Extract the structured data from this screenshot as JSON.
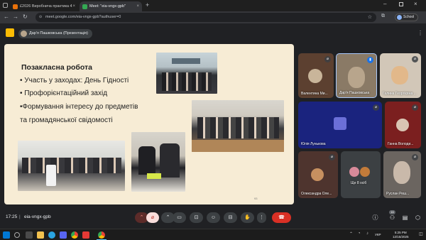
{
  "browser": {
    "tabs": [
      {
        "label": "£2026 Виробнича практикa 4",
        "active": false,
        "color": "#e8710a"
      },
      {
        "label": "Meet: \"eia-vngx-gpb\"",
        "active": true,
        "color": "#34a853"
      }
    ],
    "new_tab": "+",
    "url": "meet.google.com/eia-vngx-gpb?authuser=0",
    "profile": "School"
  },
  "meet": {
    "presenter_label": "Дар'я Пашковська (Презентація)"
  },
  "slide": {
    "title": "Позакласна робота",
    "bullets": [
      "• Участь у заходах: День Гідності",
      "• Профорієнтаційний захід",
      "•Формування інтересу до предметів",
      "та громадянської свідомості"
    ],
    "page_number": "93"
  },
  "participants": [
    {
      "name": "Валентина Ми...",
      "muted": true,
      "avatar_color": "#c9b59a",
      "bg": "#5c4030"
    },
    {
      "name": "Дар'я Пашковська",
      "muted": false,
      "avatar_color": "#b8a58c",
      "bg": "#8a7a66"
    },
    {
      "name": "Галина Георгієвна ...",
      "muted": true,
      "avatar_color": "#e2b88a",
      "bg": "#d2c7b8"
    },
    {
      "name": "Юлія Лунькова",
      "muted": true,
      "avatar_color": "#6b6fd8",
      "bg": "#1a237e"
    },
    {
      "name": "Ганна Володи...",
      "muted": true,
      "avatar_color": "#d9c5b3",
      "bg": "#7b1f1f"
    },
    {
      "name": "Олександра Оле...",
      "muted": true,
      "avatar_color": "#c79060",
      "bg": "#4e342e"
    },
    {
      "name": "Ще 8 осіб",
      "muted": false,
      "avatar_color": "#d88a9a",
      "bg": "#3c4043"
    },
    {
      "name": "Руслан Реш...",
      "muted": true,
      "avatar_color": "#c9b9aa",
      "bg": "#6b6560"
    }
  ],
  "bottom": {
    "time": "17:25",
    "separator": "|",
    "meeting_code": "eia-vngx-gpb",
    "participant_count": "16"
  },
  "taskbar": {
    "language": "УКР",
    "time": "5:25 PM",
    "date": "12/15/2025"
  },
  "colors": {
    "end_call": "#d93025",
    "muted_mic": "#f28b82",
    "slide_bg": "#f7ecd5",
    "meet_bg": "#202124"
  }
}
